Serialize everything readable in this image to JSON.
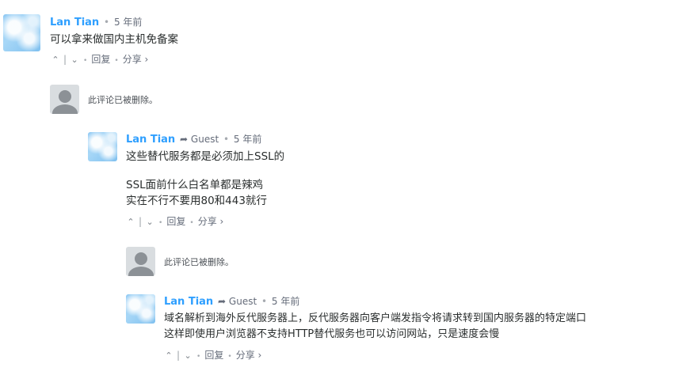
{
  "comments": [
    {
      "author": "Lan Tian",
      "time": "5 年前",
      "lines": [
        "可以拿来做国内主机免备案"
      ],
      "actions": {
        "upvote": "^",
        "downvote": "v",
        "reply": "回复",
        "share": "分享 ›"
      }
    },
    {
      "deleted_text": "此评论已被删除。"
    },
    {
      "author": "Lan Tian",
      "reply_to": "Guest",
      "time": "5 年前",
      "lines": [
        "这些替代服务都是必须加上SSL的",
        "",
        "SSL面前什么白名单都是辣鸡",
        "实在不行不要用80和443就行"
      ],
      "actions": {
        "upvote": "^",
        "downvote": "v",
        "reply": "回复",
        "share": "分享 ›"
      }
    },
    {
      "deleted_text": "此评论已被删除。"
    },
    {
      "author": "Lan Tian",
      "reply_to": "Guest",
      "time": "5 年前",
      "lines": [
        "域名解析到海外反代服务器上，反代服务器向客户端发指令将请求转到国内服务器的特定端口",
        "这样即使用户浏览器不支持HTTP替代服务也可以访问网站，只是速度会慢"
      ],
      "actions": {
        "upvote": "^",
        "downvote": "v",
        "reply": "回复",
        "share": "分享 ›"
      }
    }
  ],
  "separator_dot": "•",
  "reply_arrow": "➦"
}
